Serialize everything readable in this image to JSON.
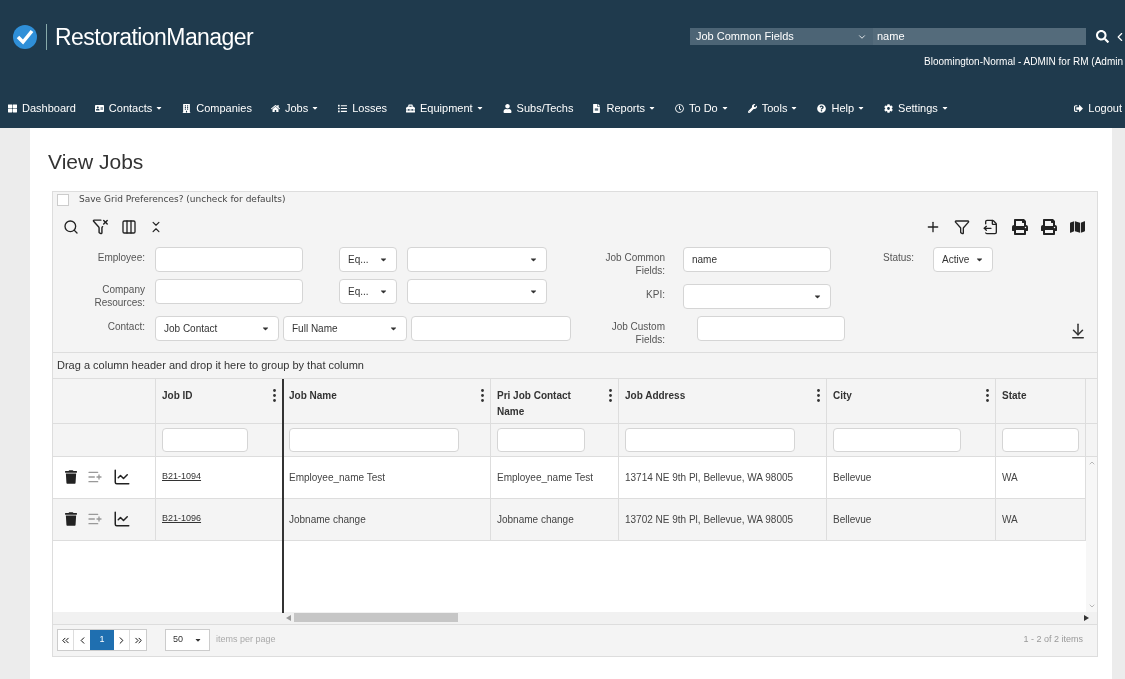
{
  "header": {
    "logo_text": "RestorationManager",
    "search_scope": "Job Common Fields",
    "search_value": "name",
    "user_line": "Bloomington-Normal - ADMIN for RM (Admin"
  },
  "nav": {
    "items": [
      {
        "label": "Dashboard",
        "dropdown": false
      },
      {
        "label": "Contacts",
        "dropdown": true
      },
      {
        "label": "Companies",
        "dropdown": false
      },
      {
        "label": "Jobs",
        "dropdown": true
      },
      {
        "label": "Losses",
        "dropdown": false
      },
      {
        "label": "Equipment",
        "dropdown": true
      },
      {
        "label": "Subs/Techs",
        "dropdown": false
      },
      {
        "label": "Reports",
        "dropdown": true
      },
      {
        "label": "To Do",
        "dropdown": true
      },
      {
        "label": "Tools",
        "dropdown": true
      },
      {
        "label": "Help",
        "dropdown": true
      },
      {
        "label": "Settings",
        "dropdown": true
      }
    ],
    "logout": "Logout"
  },
  "page_title": "View Jobs",
  "save_prefs": {
    "label": "Save Grid Preferences? (uncheck for defaults)",
    "checked": false
  },
  "filters": {
    "employee_label": "Employee:",
    "employee_operator": "Eq...",
    "company_label": "Company Resources:",
    "company_operator": "Eq...",
    "contact_label": "Contact:",
    "contact_type": "Job Contact",
    "contact_field": "Full Name",
    "common_label": "Job Common Fields:",
    "common_value": "name",
    "kpi_label": "KPI:",
    "custom_label": "Job Custom Fields:",
    "status_label": "Status:",
    "status_value": "Active"
  },
  "group_hint": "Drag a column header and drop it here to group by that column",
  "table": {
    "columns": [
      {
        "label": "Job ID"
      },
      {
        "label": "Job Name"
      },
      {
        "label": "Pri Job Contact Name"
      },
      {
        "label": "Job Address"
      },
      {
        "label": "City"
      },
      {
        "label": "State"
      }
    ],
    "rows": [
      {
        "job_id": "B21-1094",
        "job_name": "Employee_name Test",
        "contact": "Employee_name Test",
        "address": "13714 NE 9th Pl, Bellevue, WA 98005",
        "city": "Bellevue",
        "state": "WA"
      },
      {
        "job_id": "B21-1096",
        "job_name": "Jobname change",
        "contact": "Jobname change",
        "address": "13702 NE 9th Pl, Bellevue, WA 98005",
        "city": "Bellevue",
        "state": "WA"
      }
    ]
  },
  "pager": {
    "pages": [
      {
        "label": "1",
        "selected": true
      }
    ],
    "page_size": "50",
    "page_size_label": "items per page",
    "summary": "1 - 2 of 2 items"
  }
}
